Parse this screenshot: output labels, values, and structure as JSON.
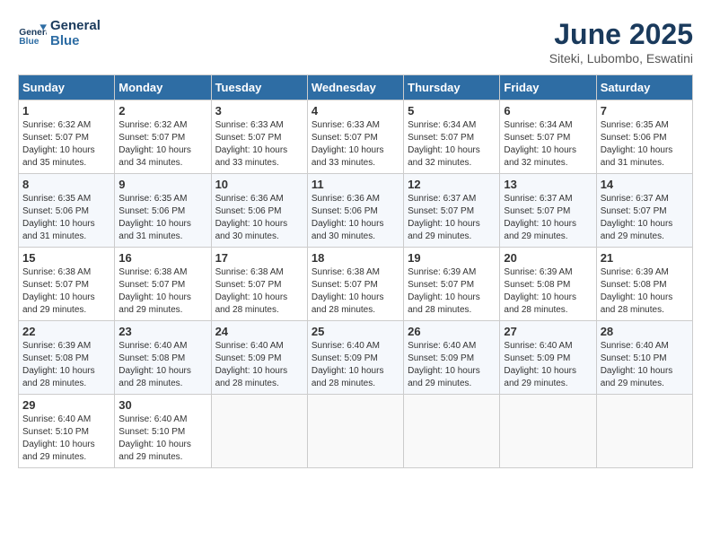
{
  "header": {
    "logo_line1": "General",
    "logo_line2": "Blue",
    "title": "June 2025",
    "subtitle": "Siteki, Lubombo, Eswatini"
  },
  "days_of_week": [
    "Sunday",
    "Monday",
    "Tuesday",
    "Wednesday",
    "Thursday",
    "Friday",
    "Saturday"
  ],
  "weeks": [
    [
      {
        "day": "1",
        "sunrise": "6:32 AM",
        "sunset": "5:07 PM",
        "daylight": "10 hours and 35 minutes."
      },
      {
        "day": "2",
        "sunrise": "6:32 AM",
        "sunset": "5:07 PM",
        "daylight": "10 hours and 34 minutes."
      },
      {
        "day": "3",
        "sunrise": "6:33 AM",
        "sunset": "5:07 PM",
        "daylight": "10 hours and 33 minutes."
      },
      {
        "day": "4",
        "sunrise": "6:33 AM",
        "sunset": "5:07 PM",
        "daylight": "10 hours and 33 minutes."
      },
      {
        "day": "5",
        "sunrise": "6:34 AM",
        "sunset": "5:07 PM",
        "daylight": "10 hours and 32 minutes."
      },
      {
        "day": "6",
        "sunrise": "6:34 AM",
        "sunset": "5:07 PM",
        "daylight": "10 hours and 32 minutes."
      },
      {
        "day": "7",
        "sunrise": "6:35 AM",
        "sunset": "5:06 PM",
        "daylight": "10 hours and 31 minutes."
      }
    ],
    [
      {
        "day": "8",
        "sunrise": "6:35 AM",
        "sunset": "5:06 PM",
        "daylight": "10 hours and 31 minutes."
      },
      {
        "day": "9",
        "sunrise": "6:35 AM",
        "sunset": "5:06 PM",
        "daylight": "10 hours and 31 minutes."
      },
      {
        "day": "10",
        "sunrise": "6:36 AM",
        "sunset": "5:06 PM",
        "daylight": "10 hours and 30 minutes."
      },
      {
        "day": "11",
        "sunrise": "6:36 AM",
        "sunset": "5:06 PM",
        "daylight": "10 hours and 30 minutes."
      },
      {
        "day": "12",
        "sunrise": "6:37 AM",
        "sunset": "5:07 PM",
        "daylight": "10 hours and 29 minutes."
      },
      {
        "day": "13",
        "sunrise": "6:37 AM",
        "sunset": "5:07 PM",
        "daylight": "10 hours and 29 minutes."
      },
      {
        "day": "14",
        "sunrise": "6:37 AM",
        "sunset": "5:07 PM",
        "daylight": "10 hours and 29 minutes."
      }
    ],
    [
      {
        "day": "15",
        "sunrise": "6:38 AM",
        "sunset": "5:07 PM",
        "daylight": "10 hours and 29 minutes."
      },
      {
        "day": "16",
        "sunrise": "6:38 AM",
        "sunset": "5:07 PM",
        "daylight": "10 hours and 29 minutes."
      },
      {
        "day": "17",
        "sunrise": "6:38 AM",
        "sunset": "5:07 PM",
        "daylight": "10 hours and 28 minutes."
      },
      {
        "day": "18",
        "sunrise": "6:38 AM",
        "sunset": "5:07 PM",
        "daylight": "10 hours and 28 minutes."
      },
      {
        "day": "19",
        "sunrise": "6:39 AM",
        "sunset": "5:07 PM",
        "daylight": "10 hours and 28 minutes."
      },
      {
        "day": "20",
        "sunrise": "6:39 AM",
        "sunset": "5:08 PM",
        "daylight": "10 hours and 28 minutes."
      },
      {
        "day": "21",
        "sunrise": "6:39 AM",
        "sunset": "5:08 PM",
        "daylight": "10 hours and 28 minutes."
      }
    ],
    [
      {
        "day": "22",
        "sunrise": "6:39 AM",
        "sunset": "5:08 PM",
        "daylight": "10 hours and 28 minutes."
      },
      {
        "day": "23",
        "sunrise": "6:40 AM",
        "sunset": "5:08 PM",
        "daylight": "10 hours and 28 minutes."
      },
      {
        "day": "24",
        "sunrise": "6:40 AM",
        "sunset": "5:09 PM",
        "daylight": "10 hours and 28 minutes."
      },
      {
        "day": "25",
        "sunrise": "6:40 AM",
        "sunset": "5:09 PM",
        "daylight": "10 hours and 28 minutes."
      },
      {
        "day": "26",
        "sunrise": "6:40 AM",
        "sunset": "5:09 PM",
        "daylight": "10 hours and 29 minutes."
      },
      {
        "day": "27",
        "sunrise": "6:40 AM",
        "sunset": "5:09 PM",
        "daylight": "10 hours and 29 minutes."
      },
      {
        "day": "28",
        "sunrise": "6:40 AM",
        "sunset": "5:10 PM",
        "daylight": "10 hours and 29 minutes."
      }
    ],
    [
      {
        "day": "29",
        "sunrise": "6:40 AM",
        "sunset": "5:10 PM",
        "daylight": "10 hours and 29 minutes."
      },
      {
        "day": "30",
        "sunrise": "6:40 AM",
        "sunset": "5:10 PM",
        "daylight": "10 hours and 29 minutes."
      },
      null,
      null,
      null,
      null,
      null
    ]
  ],
  "labels": {
    "sunrise": "Sunrise:",
    "sunset": "Sunset:",
    "daylight": "Daylight:"
  }
}
